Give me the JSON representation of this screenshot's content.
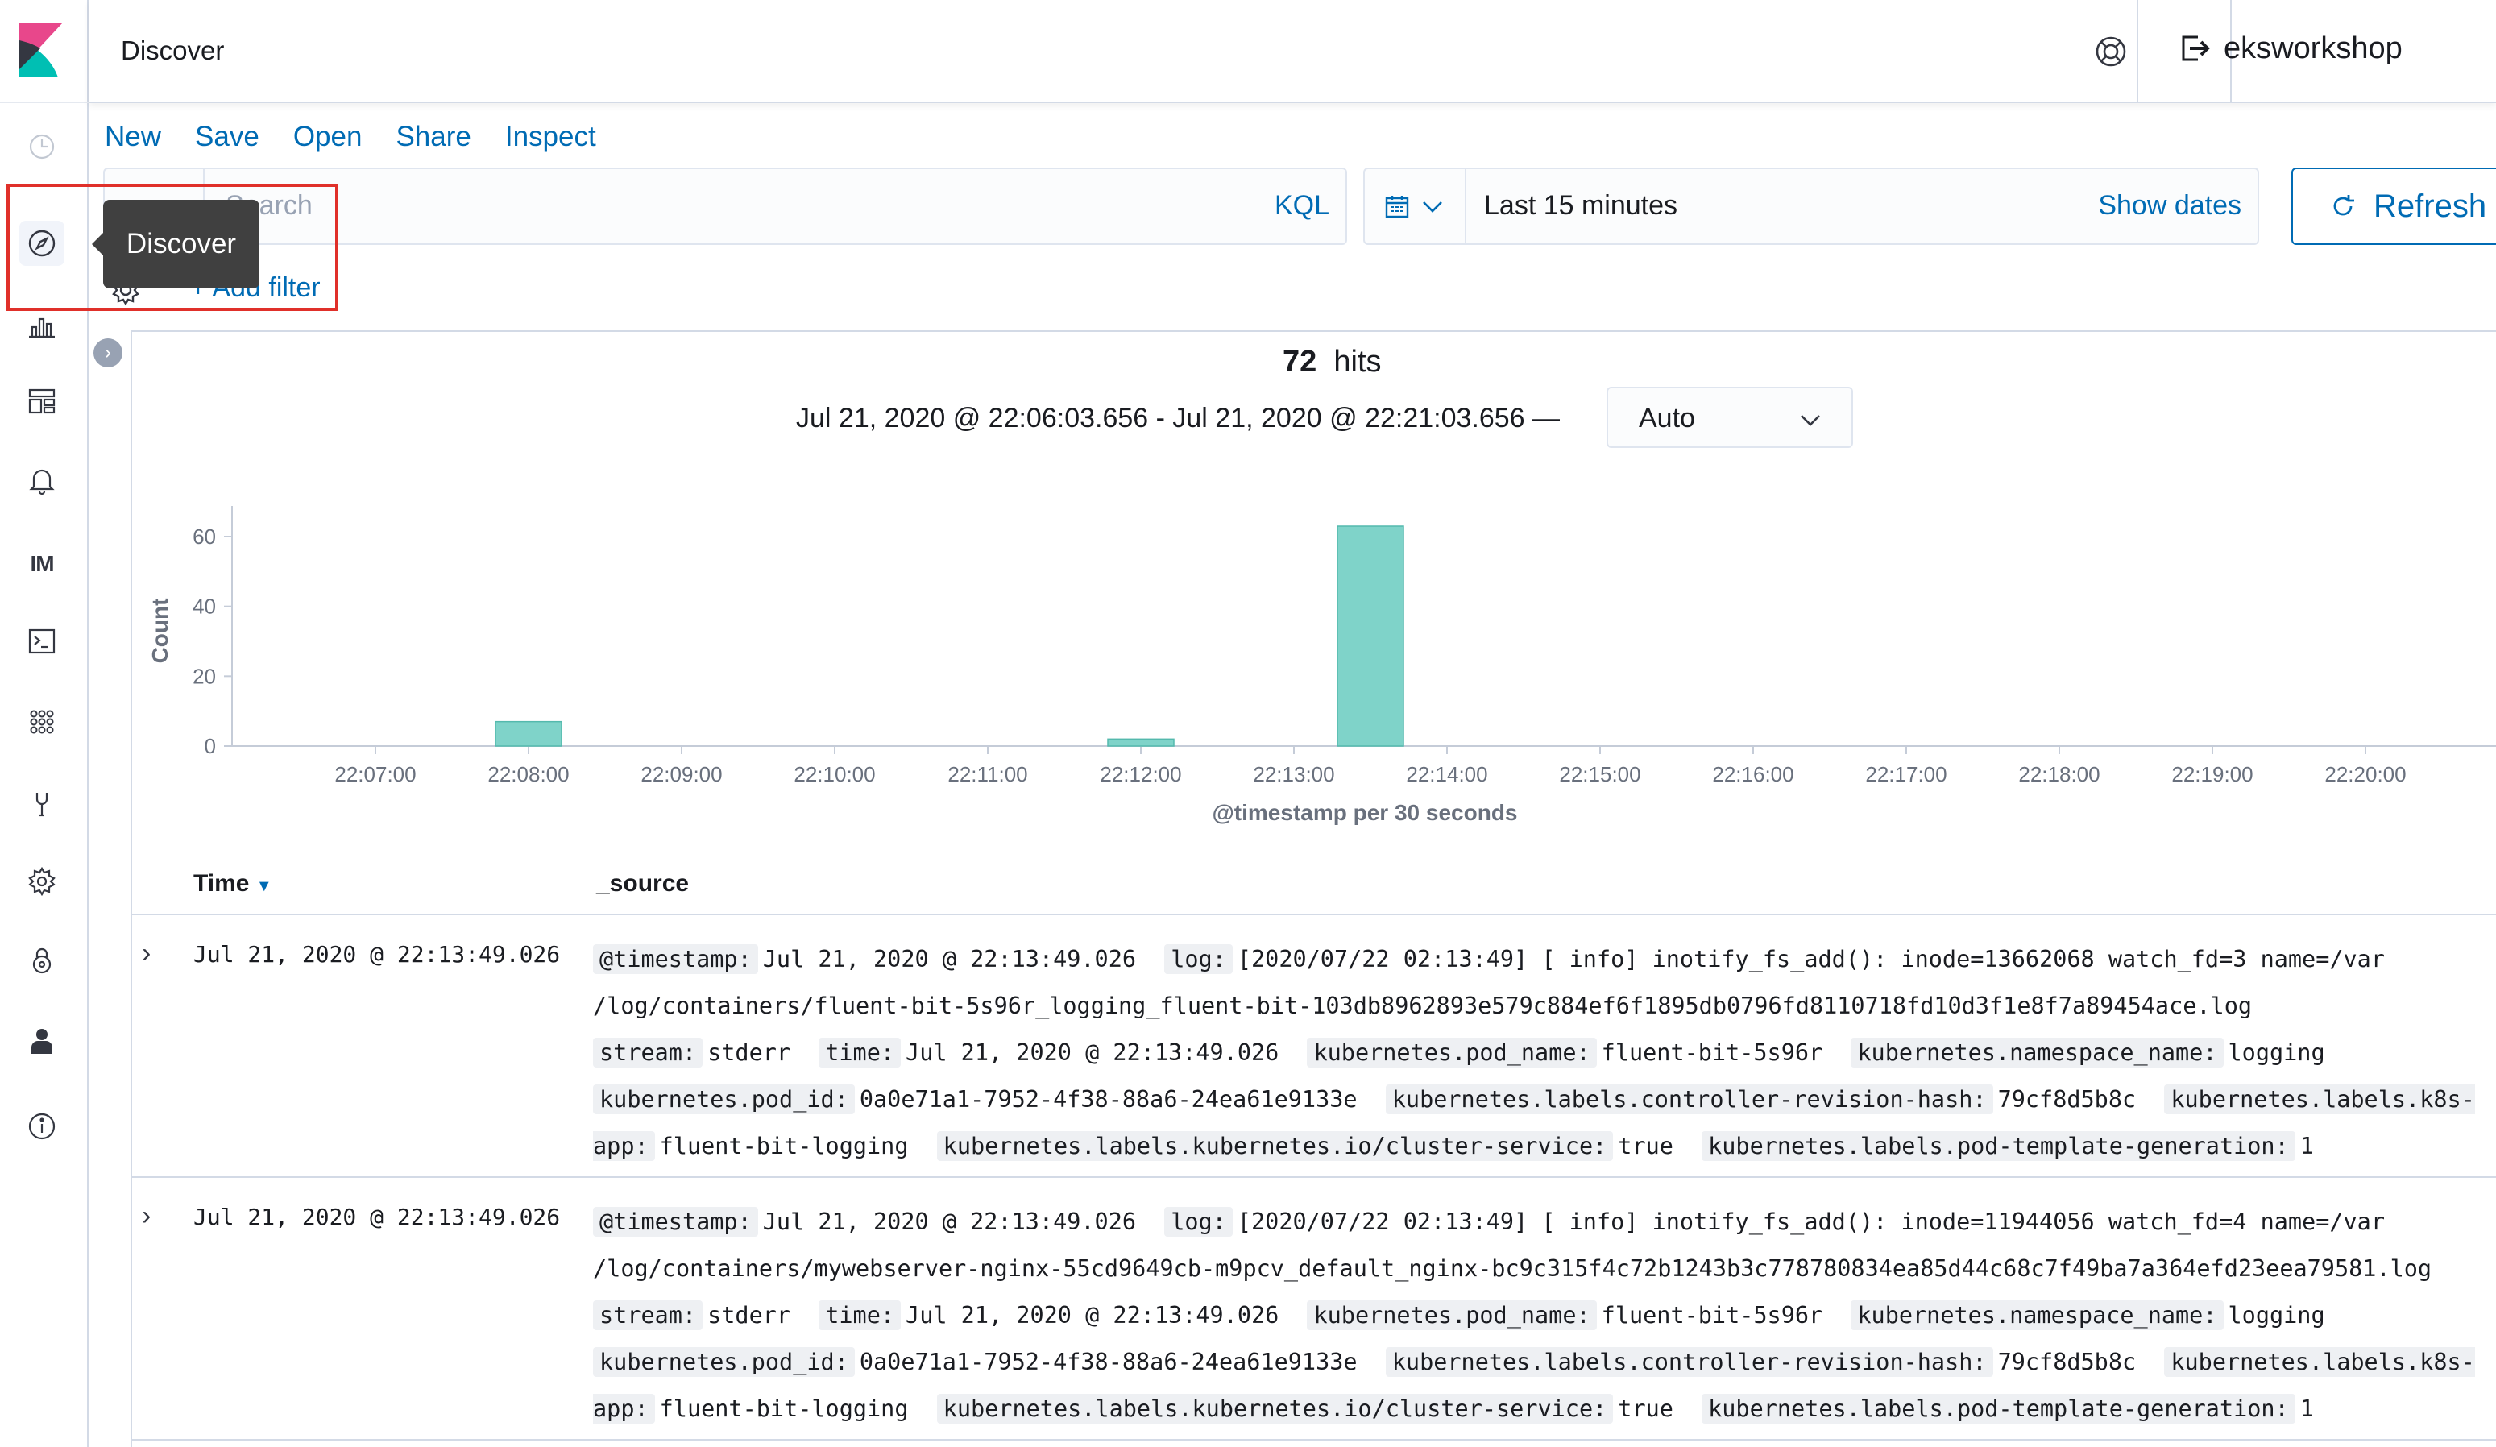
{
  "nav": {
    "items": [
      {
        "name": "recently-viewed-icon"
      },
      {
        "name": "discover-icon"
      },
      {
        "name": "visualize-icon"
      },
      {
        "name": "dashboard-icon"
      },
      {
        "name": "alerting-icon"
      },
      {
        "name": "im-icon",
        "label": "IM"
      },
      {
        "name": "dev-tools-icon"
      },
      {
        "name": "apps-icon"
      },
      {
        "name": "wrench-icon"
      },
      {
        "name": "management-icon"
      },
      {
        "name": "security-icon"
      },
      {
        "name": "user-icon"
      },
      {
        "name": "info-icon"
      }
    ]
  },
  "header": {
    "title": "Discover",
    "user": "eksworkshop"
  },
  "topmenu": [
    "New",
    "Save",
    "Open",
    "Share",
    "Inspect"
  ],
  "query": {
    "placeholder": "Search",
    "language": "KQL",
    "add_filter": "+ Add filter"
  },
  "datepicker": {
    "range": "Last 15 minutes",
    "show_dates": "Show dates",
    "refresh": "Refresh"
  },
  "tooltip": "Discover",
  "summary": {
    "hits_count": "72",
    "hits_label": "hits",
    "time_range": "Jul 21, 2020 @ 22:06:03.656 - Jul 21, 2020 @ 22:21:03.656 —",
    "interval": "Auto"
  },
  "chart_data": {
    "type": "bar",
    "x": [
      "22:08:00",
      "22:12:00",
      "22:13:30"
    ],
    "values": [
      7,
      2,
      63
    ],
    "x_ticks": [
      "22:07:00",
      "22:08:00",
      "22:09:00",
      "22:10:00",
      "22:11:00",
      "22:12:00",
      "22:13:00",
      "22:14:00",
      "22:15:00",
      "22:16:00",
      "22:17:00",
      "22:18:00",
      "22:19:00",
      "22:20:00"
    ],
    "y_ticks": [
      0,
      20,
      40,
      60
    ],
    "ylim": [
      0,
      66
    ],
    "xlabel": "@timestamp per 30 seconds",
    "ylabel": "Count",
    "color": "#7fd3c9"
  },
  "table": {
    "col_time": "Time",
    "col_source": "_source",
    "rows": [
      {
        "time": "Jul 21, 2020 @ 22:13:49.026",
        "fields": [
          {
            "k": "@timestamp:",
            "v": "Jul 21, 2020 @ 22:13:49.026"
          },
          {
            "k": "log:",
            "v": "[2020/07/22 02:13:49] [ info] inotify_fs_add(): inode=13662068 watch_fd=3 name=/var /log/containers/fluent-bit-5s96r_logging_fluent-bit-103db8962893e579c884ef6f1895db0796fd8110718fd10d3f1e8f7a89454ace.log"
          },
          {
            "k": "stream:",
            "v": "stderr"
          },
          {
            "k": "time:",
            "v": "Jul 21, 2020 @ 22:13:49.026"
          },
          {
            "k": "kubernetes.pod_name:",
            "v": "fluent-bit-5s96r"
          },
          {
            "k": "kubernetes.namespace_name:",
            "v": "logging"
          },
          {
            "k": "kubernetes.pod_id:",
            "v": "0a0e71a1-7952-4f38-88a6-24ea61e9133e"
          },
          {
            "k": "kubernetes.labels.controller-revision-hash:",
            "v": "79cf8d5b8c"
          },
          {
            "k": "kubernetes.labels.k8s-app:",
            "v": "fluent-bit-logging"
          },
          {
            "k": "kubernetes.labels.kubernetes.io/cluster-service:",
            "v": "true"
          },
          {
            "k": "kubernetes.labels.pod-template-generation:",
            "v": "1"
          }
        ]
      },
      {
        "time": "Jul 21, 2020 @ 22:13:49.026",
        "fields": [
          {
            "k": "@timestamp:",
            "v": "Jul 21, 2020 @ 22:13:49.026"
          },
          {
            "k": "log:",
            "v": "[2020/07/22 02:13:49] [ info] inotify_fs_add(): inode=11944056 watch_fd=4 name=/var /log/containers/mywebserver-nginx-55cd9649cb-m9pcv_default_nginx-bc9c315f4c72b1243b3c778780834ea85d44c68c7f49ba7a364efd23eea79581.log"
          },
          {
            "k": "stream:",
            "v": "stderr"
          },
          {
            "k": "time:",
            "v": "Jul 21, 2020 @ 22:13:49.026"
          },
          {
            "k": "kubernetes.pod_name:",
            "v": "fluent-bit-5s96r"
          },
          {
            "k": "kubernetes.namespace_name:",
            "v": "logging"
          },
          {
            "k": "kubernetes.pod_id:",
            "v": "0a0e71a1-7952-4f38-88a6-24ea61e9133e"
          },
          {
            "k": "kubernetes.labels.controller-revision-hash:",
            "v": "79cf8d5b8c"
          },
          {
            "k": "kubernetes.labels.k8s-app:",
            "v": "fluent-bit-logging"
          },
          {
            "k": "kubernetes.labels.kubernetes.io/cluster-service:",
            "v": "true"
          },
          {
            "k": "kubernetes.labels.pod-template-generation:",
            "v": "1"
          }
        ]
      }
    ]
  }
}
